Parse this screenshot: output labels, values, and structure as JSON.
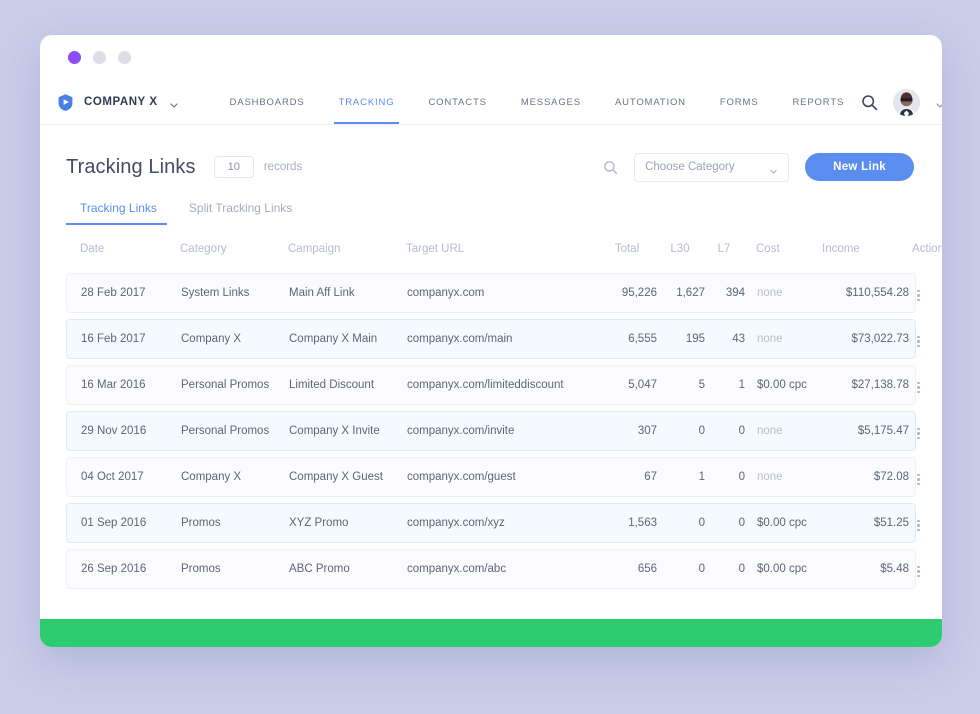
{
  "window": {
    "dots": [
      "purple",
      "grey",
      "grey"
    ],
    "dot_colors": {
      "active": "#8b4ef5",
      "inactive": "#dcdde6"
    }
  },
  "nav": {
    "brand": "COMPANY X",
    "logo_icon": "shield-play-icon",
    "brand_caret_icon": "chevron-down-icon",
    "links": [
      {
        "label": "DASHBOARDS",
        "active": false
      },
      {
        "label": "TRACKING",
        "active": true
      },
      {
        "label": "CONTACTS",
        "active": false
      },
      {
        "label": "MESSAGES",
        "active": false
      },
      {
        "label": "AUTOMATION",
        "active": false
      },
      {
        "label": "FORMS",
        "active": false
      },
      {
        "label": "REPORTS",
        "active": false
      }
    ],
    "search_icon": "search-icon",
    "avatar_icon": "user-avatar",
    "account_caret_icon": "chevron-down-icon",
    "accent_color": "#5b8def"
  },
  "header": {
    "title": "Tracking Links",
    "record_count": "10",
    "records_label": "records",
    "search_icon": "search-icon",
    "category_select": {
      "placeholder": "Choose Category",
      "caret_icon": "chevron-down-icon"
    },
    "new_link_button": "New Link",
    "button_color": "#5b8def"
  },
  "tabs": [
    {
      "label": "Tracking Links",
      "active": true
    },
    {
      "label": "Split Tracking Links",
      "active": false
    }
  ],
  "table": {
    "columns": [
      "Date",
      "Category",
      "Campaign",
      "Target URL",
      "Total",
      "L30",
      "L7",
      "Cost",
      "Income",
      "Action"
    ],
    "rows": [
      {
        "date": "28 Feb 2017",
        "category": "System Links",
        "campaign": "Main Aff Link",
        "url": "companyx.com",
        "total": "95,226",
        "l30": "1,627",
        "l7": "394",
        "cost": "none",
        "cost_muted": true,
        "income": "$110,554.28",
        "highlight": false
      },
      {
        "date": "16 Feb 2017",
        "category": "Company X",
        "campaign": "Company X Main",
        "url": "companyx.com/main",
        "total": "6,555",
        "l30": "195",
        "l7": "43",
        "cost": "none",
        "cost_muted": true,
        "income": "$73,022.73",
        "highlight": true
      },
      {
        "date": "16 Mar 2016",
        "category": "Personal Promos",
        "campaign": "Limited Discount",
        "url": "companyx.com/limiteddiscount",
        "total": "5,047",
        "l30": "5",
        "l7": "1",
        "cost": "$0.00 cpc",
        "cost_muted": false,
        "income": "$27,138.78",
        "highlight": false
      },
      {
        "date": "29 Nov 2016",
        "category": "Personal Promos",
        "campaign": "Company X Invite",
        "url": "companyx.com/invite",
        "total": "307",
        "l30": "0",
        "l7": "0",
        "cost": "none",
        "cost_muted": true,
        "income": "$5,175.47",
        "highlight": true
      },
      {
        "date": "04 Oct 2017",
        "category": "Company X",
        "campaign": "Company X Guest",
        "url": "companyx.com/guest",
        "total": "67",
        "l30": "1",
        "l7": "0",
        "cost": "none",
        "cost_muted": true,
        "income": "$72.08",
        "highlight": false
      },
      {
        "date": "01 Sep 2016",
        "category": "Promos",
        "campaign": "XYZ Promo",
        "url": "companyx.com/xyz",
        "total": "1,563",
        "l30": "0",
        "l7": "0",
        "cost": "$0.00 cpc",
        "cost_muted": false,
        "income": "$51.25",
        "highlight": true
      },
      {
        "date": "26 Sep 2016",
        "category": "Promos",
        "campaign": "ABC Promo",
        "url": "companyx.com/abc",
        "total": "656",
        "l30": "0",
        "l7": "0",
        "cost": "$0.00 cpc",
        "cost_muted": false,
        "income": "$5.48",
        "highlight": false
      }
    ],
    "row_action_icon": "kebab-menu-icon"
  },
  "footer": {
    "color": "#2ecc71"
  },
  "page": {
    "background_color": "#c9cde8"
  }
}
